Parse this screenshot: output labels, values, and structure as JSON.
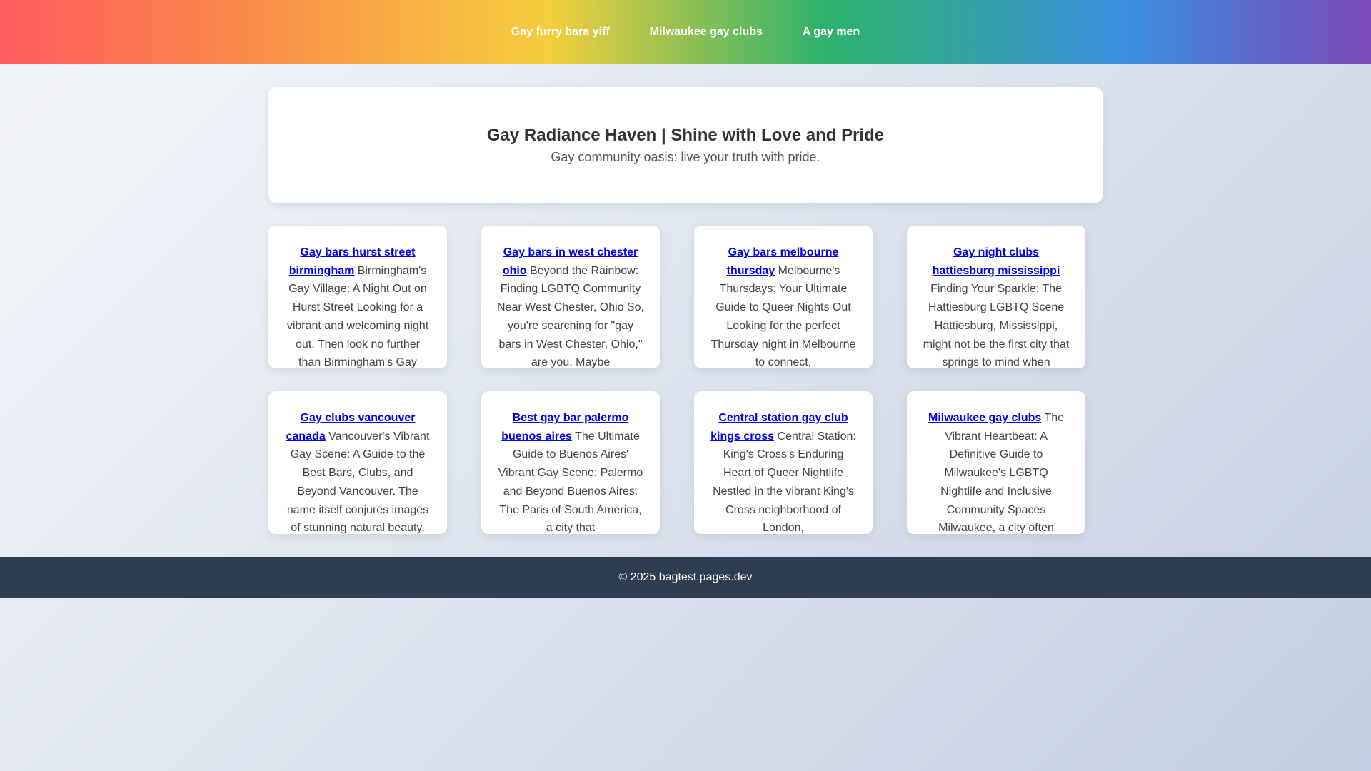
{
  "nav": {
    "links": [
      {
        "label": "Gay furry bara yiff"
      },
      {
        "label": "Milwaukee gay clubs"
      },
      {
        "label": "A gay men"
      }
    ]
  },
  "hero": {
    "title": "Gay Radiance Haven | Shine with Love and Pride",
    "subtitle": "Gay community oasis: live your truth with pride."
  },
  "cards": [
    {
      "link": "Gay bars hurst street birmingham",
      "text": " Birmingham's Gay Village: A Night Out on Hurst Street Looking for a vibrant and welcoming night out. Then look no further than Birmingham's Gay"
    },
    {
      "link": "Gay bars in west chester ohio",
      "text": " Beyond the Rainbow: Finding LGBTQ Community Near West Chester, Ohio So, you're searching for \"gay bars in West Chester, Ohio,\" are you. Maybe"
    },
    {
      "link": "Gay bars melbourne thursday",
      "text": " Melbourne's Thursdays: Your Ultimate Guide to Queer Nights Out Looking for the perfect Thursday night in Melbourne to connect,"
    },
    {
      "link": "Gay night clubs hattiesburg mississippi",
      "text": " Finding Your Sparkle: The Hattiesburg LGBTQ Scene Hattiesburg, Mississippi, might not be the first city that springs to mind when"
    },
    {
      "link": "Gay clubs vancouver canada",
      "text": " Vancouver's Vibrant Gay Scene: A Guide to the Best Bars, Clubs, and Beyond Vancouver. The name itself conjures images of stunning natural beauty,"
    },
    {
      "link": "Best gay bar palermo buenos aires",
      "text": " The Ultimate Guide to Buenos Aires' Vibrant Gay Scene: Palermo and Beyond Buenos Aires. The Paris of South America, a city that"
    },
    {
      "link": "Central station gay club kings cross",
      "text": " Central Station: King's Cross's Enduring Heart of Queer Nightlife Nestled in the vibrant King's Cross neighborhood of London,"
    },
    {
      "link": "Milwaukee gay clubs",
      "text": " The Vibrant Heartbeat: A Definitive Guide to Milwaukee's LGBTQ Nightlife and Inclusive Community Spaces Milwaukee, a city often"
    }
  ],
  "footer": {
    "text": "© 2025 bagtest.pages.dev"
  }
}
